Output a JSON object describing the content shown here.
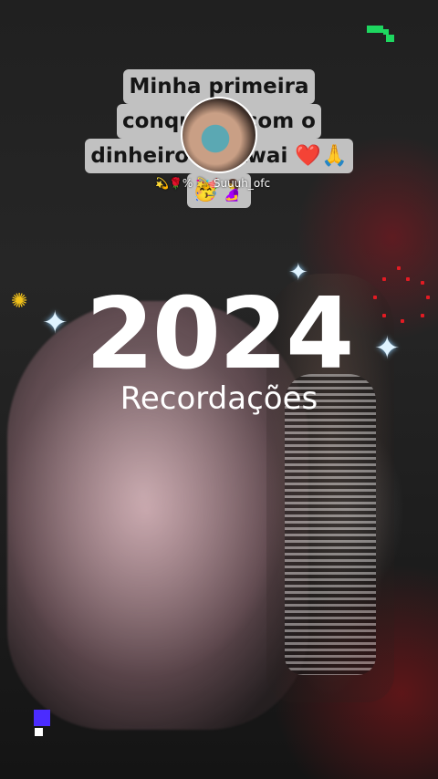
{
  "caption": {
    "line1": "Minha primeira",
    "line2": "conquista com o",
    "line3": "dinheiro do kwai ❤️🙏",
    "line4": "🥳🤰"
  },
  "profile": {
    "username": "💫🌹% 💫 Suuuh_ofc"
  },
  "recap": {
    "year": "2024",
    "subtitle": "Recordações"
  },
  "colors": {
    "brand": "#1ed760",
    "accent_purple": "#4b2cff",
    "sun_yellow": "#f2c21b",
    "dot_red": "#e31b23"
  },
  "icons": {
    "app_logo": "pixel-logo-icon",
    "sparkle": "sparkle-icon",
    "sun": "sun-icon"
  }
}
